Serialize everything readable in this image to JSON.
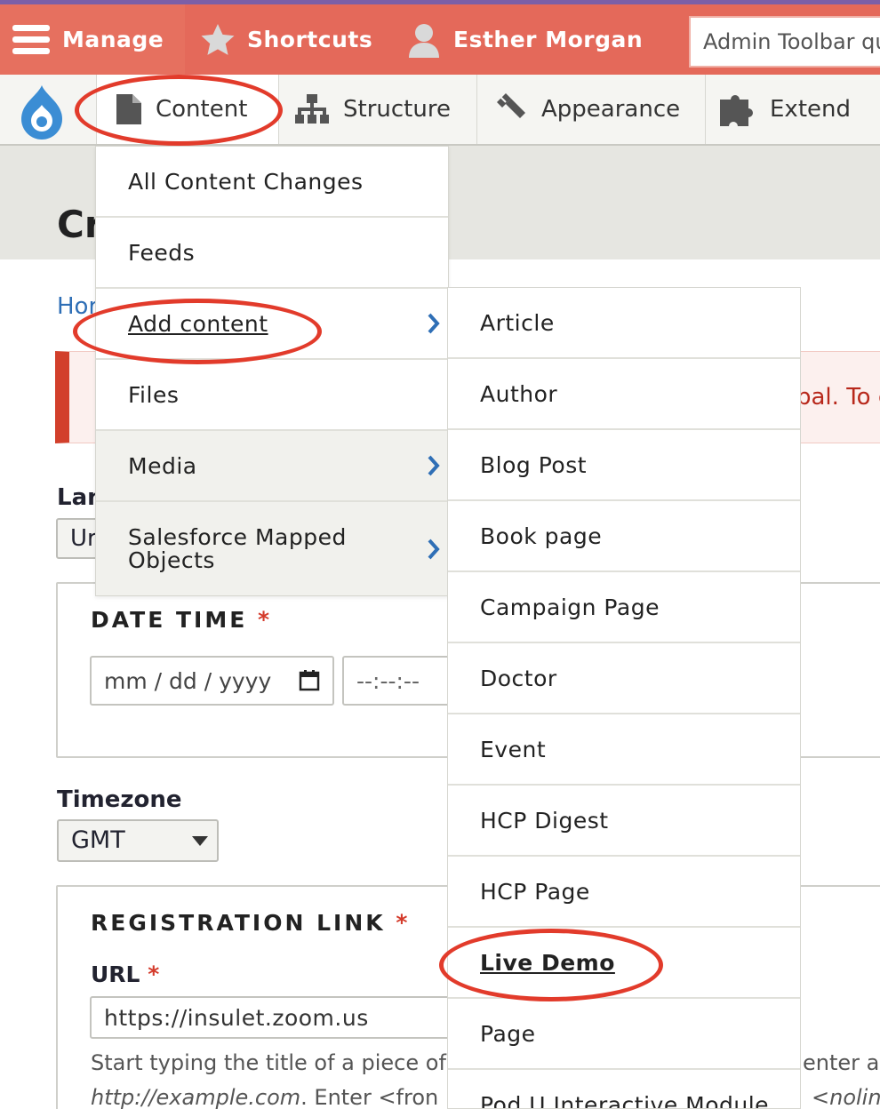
{
  "toolbar": {
    "manage": "Manage",
    "shortcuts": "Shortcuts",
    "user": "Esther Morgan",
    "search_placeholder": "Admin Toolbar quick search",
    "colors": {
      "bar": "#e4695a",
      "accent_line": "#7b5fa8"
    }
  },
  "tray": {
    "items": [
      {
        "label": "Content",
        "icon": "document-icon"
      },
      {
        "label": "Structure",
        "icon": "sitemap-icon"
      },
      {
        "label": "Appearance",
        "icon": "paintbrush-icon"
      },
      {
        "label": "Extend",
        "icon": "puzzle-icon"
      }
    ]
  },
  "page": {
    "title": "Cr",
    "breadcrumb": "Hor",
    "message_fragment": "bal. To c",
    "language_label": "Lan",
    "language_value": "Ur",
    "date_time_legend": "DATE TIME",
    "required_marker": "*",
    "date_placeholder": "mm / dd / yyyy",
    "time_placeholder": "--:--:--",
    "timezone_label": "Timezone",
    "timezone_value": "GMT",
    "registration_legend": "REGISTRATION LINK",
    "url_label": "URL",
    "url_value": "https://insulet.zoom.us",
    "help_line1": "Start typing the title of a piece of",
    "help_line1_right": "enter a",
    "help_line2_link": "http://example.com",
    "help_line2_rest": ". Enter <fron",
    "help_line2_right": "<nolin"
  },
  "content_menu": {
    "items": [
      {
        "label": "All Content Changes"
      },
      {
        "label": "Feeds"
      },
      {
        "label": "Add content",
        "has_submenu": true
      },
      {
        "label": "Files"
      },
      {
        "label": "Media",
        "has_submenu": true
      },
      {
        "label": "Salesforce Mapped Objects",
        "has_submenu": true
      }
    ]
  },
  "add_content_menu": {
    "items": [
      "Article",
      "Author",
      "Blog Post",
      "Book page",
      "Campaign Page",
      "Doctor",
      "Event",
      "HCP Digest",
      "HCP Page",
      "Live Demo",
      "Page",
      "Pod U Interactive Module"
    ],
    "highlighted": "Live Demo"
  },
  "annotation_color": "#e23b2b"
}
